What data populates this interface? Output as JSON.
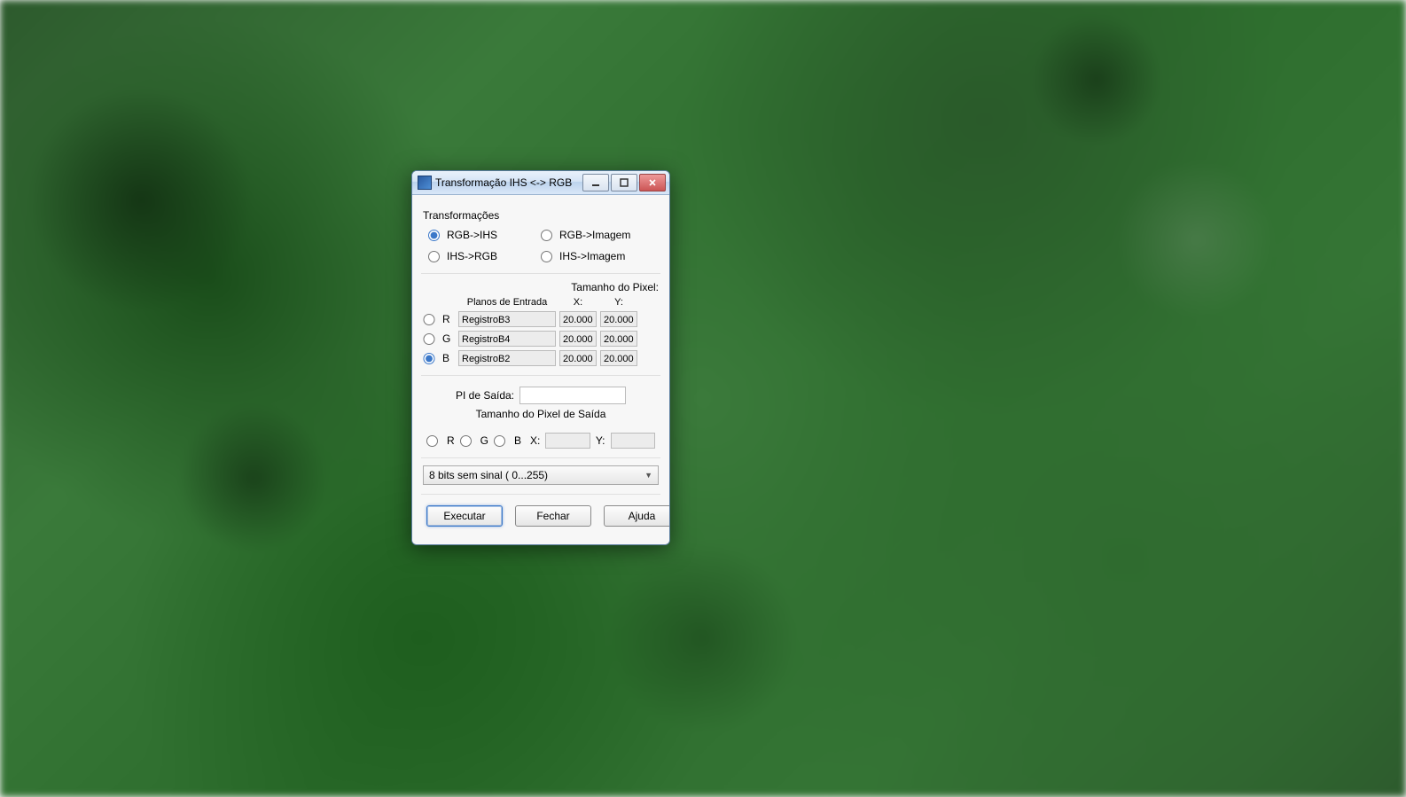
{
  "window": {
    "title": "Transformação IHS <-> RGB"
  },
  "transformacoes": {
    "label": "Transformações",
    "options": {
      "rgb_ihs": "RGB->IHS",
      "rgb_imagem": "RGB->Imagem",
      "ihs_rgb": "IHS->RGB",
      "ihs_imagem": "IHS->Imagem"
    },
    "selected": "rgb_ihs"
  },
  "entrada": {
    "pixel_size_label": "Tamanho do Pixel:",
    "planos_label": "Planos de Entrada",
    "x_label": "X:",
    "y_label": "Y:",
    "rows": [
      {
        "ch": "R",
        "plano": "RegistroB3",
        "x": "20.000",
        "y": "20.000",
        "selected": false
      },
      {
        "ch": "G",
        "plano": "RegistroB4",
        "x": "20.000",
        "y": "20.000",
        "selected": false
      },
      {
        "ch": "B",
        "plano": "RegistroB2",
        "x": "20.000",
        "y": "20.000",
        "selected": true
      }
    ]
  },
  "saida": {
    "pi_label": "PI de Saída:",
    "pi_value": "",
    "pixel_size_label": "Tamanho do Pixel de Saída",
    "r": "R",
    "g": "G",
    "b": "B",
    "x_label": "X:",
    "y_label": "Y:",
    "x_value": "",
    "y_value": ""
  },
  "bits": {
    "selected": "8 bits sem sinal ( 0...255)"
  },
  "buttons": {
    "executar": "Executar",
    "fechar": "Fechar",
    "ajuda": "Ajuda"
  }
}
